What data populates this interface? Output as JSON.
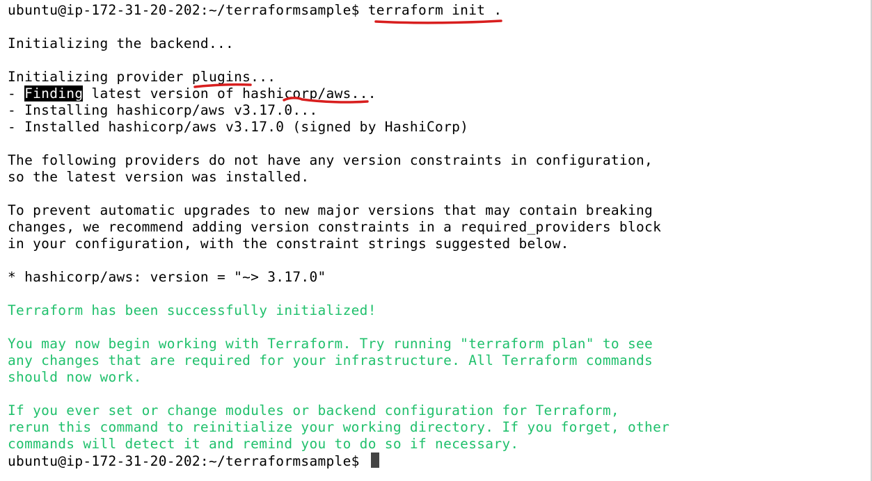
{
  "terminal": {
    "lines": [
      {
        "prompt": "ubuntu@ip-172-31-20-202:~/terraformsample$ ",
        "command": "terraform init ."
      },
      {
        "text": "Initializing the backend..."
      },
      {
        "text": "Initializing provider plugins..."
      },
      {
        "prefix": "- ",
        "highlight": "Finding",
        "rest": " latest version of hashicorp/aws..."
      },
      {
        "text": "- Installing hashicorp/aws v3.17.0..."
      },
      {
        "text": "- Installed hashicorp/aws v3.17.0 (signed by HashiCorp)"
      },
      {
        "text": "The following providers do not have any version constraints in configuration,"
      },
      {
        "text": "so the latest version was installed."
      },
      {
        "text": "To prevent automatic upgrades to new major versions that may contain breaking"
      },
      {
        "text": "changes, we recommend adding version constraints in a required_providers block"
      },
      {
        "text": "in your configuration, with the constraint strings suggested below."
      },
      {
        "text": "* hashicorp/aws: version = \"~> 3.17.0\""
      },
      {
        "text": "Terraform has been successfully initialized!"
      },
      {
        "text": "You may now begin working with Terraform. Try running \"terraform plan\" to see"
      },
      {
        "text": "any changes that are required for your infrastructure. All Terraform commands"
      },
      {
        "text": "should now work."
      },
      {
        "text": "If you ever set or change modules or backend configuration for Terraform,"
      },
      {
        "text": "rerun this command to reinitialize your working directory. If you forget, other"
      },
      {
        "text": "commands will detect it and remind you to do so if necessary."
      },
      {
        "prompt": "ubuntu@ip-172-31-20-202:~/terraformsample$ "
      }
    ]
  },
  "colors": {
    "background": "#ffffff",
    "text": "#000000",
    "success_green": "#20c06c",
    "annotation_red": "#d81e1e"
  }
}
